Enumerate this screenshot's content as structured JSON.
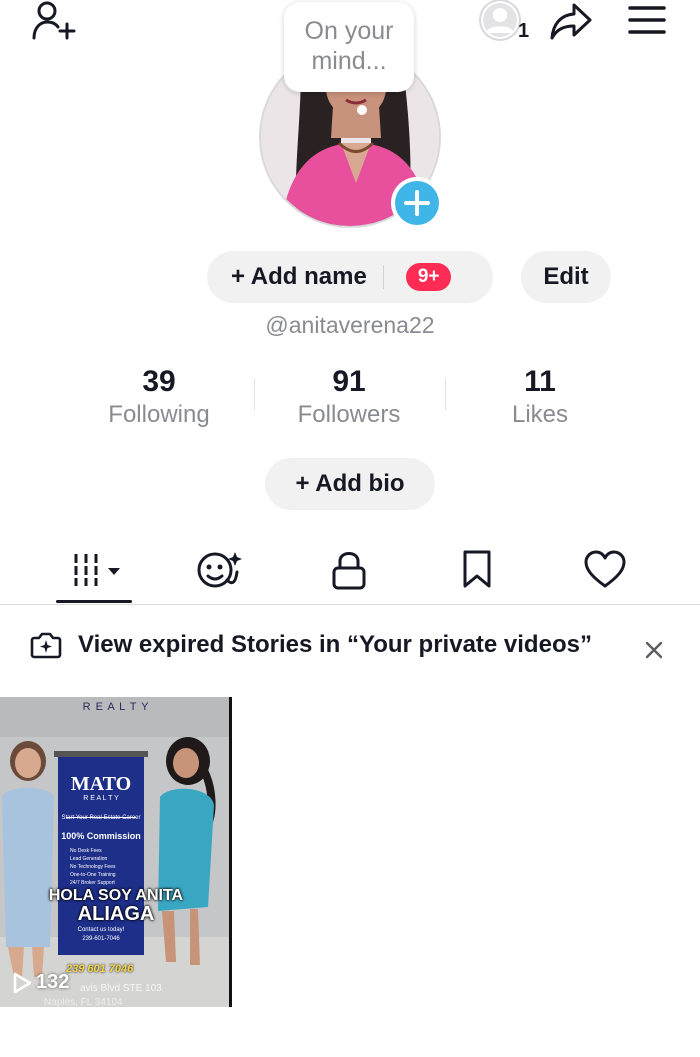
{
  "top_bar": {
    "add_friend_icon": "person-plus-icon",
    "account_badge_count": "1",
    "share_icon": "share-arrow-icon",
    "menu_icon": "hamburger-menu-icon"
  },
  "profile": {
    "mind_bubble_text_line1": "On your",
    "mind_bubble_text_line2": "mind...",
    "add_name_label": "+ Add name",
    "notification_badge": "9+",
    "edit_label": "Edit",
    "username": "@anitaverena22"
  },
  "stats": [
    {
      "value": "39",
      "label": "Following"
    },
    {
      "value": "91",
      "label": "Followers"
    },
    {
      "value": "11",
      "label": "Likes"
    }
  ],
  "bio": {
    "add_bio_label": "+ Add bio"
  },
  "tabs": [
    {
      "icon": "grid-videos-icon",
      "active": true
    },
    {
      "icon": "reposts-face-icon",
      "active": false
    },
    {
      "icon": "lock-icon",
      "active": false
    },
    {
      "icon": "bookmark-icon",
      "active": false
    },
    {
      "icon": "heart-icon",
      "active": false
    }
  ],
  "stories_notice": {
    "text": "View expired Stories in “Your private videos”",
    "close_icon": "close-icon"
  },
  "videos": [
    {
      "header": "R E A L T Y",
      "banner_title": "MATO",
      "banner_sub": "R E A L T Y",
      "banner_tag": "Start Your Real Estate Career",
      "banner_commission": "100% Commission",
      "banner_items": [
        "No Desk Fees",
        "Lead Generation",
        "No Technology Fees",
        "One-to-One Training",
        "24/7 Broker Support"
      ],
      "banner_contact": "Contact us today!",
      "banner_phone": "239-601-7046",
      "overlay_line1": "HOLA SOY ANITA",
      "overlay_line2": "ALIAGA",
      "phone_overlay": "239 601 7046",
      "address_line1": "avis Blvd STE 103",
      "address_line2": "Naples, FL 34104",
      "views": "132"
    }
  ],
  "colors": {
    "accent_blue": "#3fb5e8",
    "badge_red": "#fe2c55",
    "text_primary": "#161823",
    "text_secondary": "#8a8b91",
    "pill_bg": "#f1f1f2"
  }
}
